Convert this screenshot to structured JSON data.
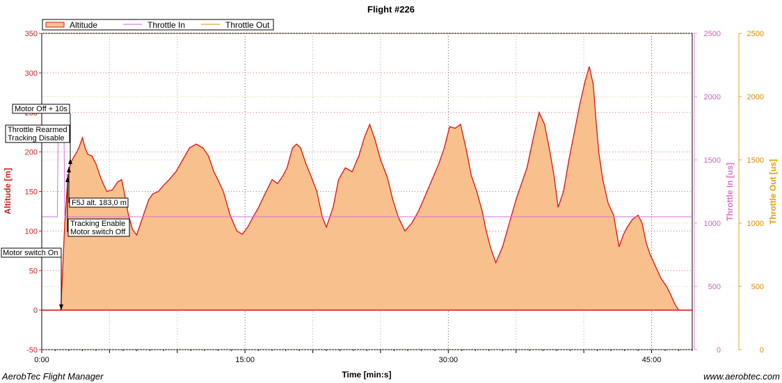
{
  "chart_data": {
    "type": "area",
    "title": "Flight #226",
    "xlabel": "Time [min:s]",
    "ylabel": "Altitude [m]",
    "ylabel_right_1": "Throttle In [us]",
    "ylabel_right_2": "Throttle Out [us]",
    "xlim_min": [
      0,
      48
    ],
    "ylim": [
      -50,
      350
    ],
    "y2lim": [
      0,
      2500
    ],
    "y3lim": [
      0,
      2500
    ],
    "x_ticks": [
      {
        "v": 0,
        "label": "0:00"
      },
      {
        "v": 15,
        "label": "15:00"
      },
      {
        "v": 30,
        "label": "30:00"
      },
      {
        "v": 45,
        "label": "45:00"
      }
    ],
    "y_ticks": [
      "-50",
      "0",
      "50",
      "100",
      "150",
      "200",
      "250",
      "300",
      "350"
    ],
    "y2_ticks": [
      "0",
      "500",
      "1000",
      "1500",
      "2000",
      "2500"
    ],
    "y3_ticks": [
      "0",
      "500",
      "1000",
      "1500",
      "2000",
      "2500"
    ],
    "legend": {
      "placement": "top-left",
      "entries": [
        {
          "label": "Altitude",
          "color": "#cc2222"
        },
        {
          "label": "Throttle In",
          "color": "#cc66cc"
        },
        {
          "label": "Throttle Out",
          "color": "#cc9900"
        }
      ]
    },
    "grid": true,
    "series": [
      {
        "name": "Altitude",
        "color": "#dd1111",
        "fill": "#f8c08c",
        "x": [
          0,
          1.4,
          1.5,
          1.7,
          1.9,
          2.1,
          2.4,
          2.6,
          2.8,
          3.0,
          3.2,
          3.4,
          3.7,
          4.0,
          4.4,
          4.8,
          5.2,
          5.6,
          5.9,
          6.1,
          6.4,
          6.7,
          7.0,
          7.3,
          7.6,
          7.9,
          8.2,
          8.6,
          9.0,
          9.4,
          9.9,
          10.4,
          10.9,
          11.4,
          11.9,
          12.3,
          12.7,
          13.0,
          13.4,
          13.9,
          14.4,
          14.8,
          15.2,
          15.6,
          16.0,
          16.5,
          17.0,
          17.4,
          17.8,
          18.1,
          18.5,
          18.8,
          19.1,
          19.5,
          19.9,
          20.3,
          20.7,
          21.0,
          21.5,
          21.9,
          22.4,
          22.9,
          23.4,
          23.8,
          24.2,
          24.6,
          25.0,
          25.5,
          25.9,
          26.3,
          26.8,
          27.3,
          27.8,
          28.3,
          28.8,
          29.3,
          29.7,
          30.1,
          30.5,
          30.9,
          31.3,
          31.7,
          32.1,
          32.5,
          32.8,
          33.1,
          33.5,
          34.0,
          34.5,
          35.0,
          35.4,
          35.8,
          36.3,
          36.7,
          37.1,
          37.5,
          37.8,
          38.1,
          38.5,
          38.9,
          39.3,
          39.7,
          40.1,
          40.4,
          40.7,
          40.9,
          41.1,
          41.4,
          41.8,
          42.2,
          42.6,
          42.9,
          43.2,
          43.6,
          44.0,
          44.3,
          44.6,
          44.9,
          45.3,
          45.7,
          46.1,
          46.4,
          46.7,
          47.0,
          47.3,
          47.6,
          48.0
        ],
        "y": [
          0,
          0,
          35,
          110,
          160,
          185,
          195,
          200,
          208,
          218,
          205,
          197,
          195,
          185,
          165,
          150,
          152,
          162,
          165,
          148,
          120,
          102,
          95,
          110,
          125,
          140,
          147,
          150,
          158,
          165,
          175,
          190,
          205,
          210,
          205,
          195,
          175,
          165,
          150,
          120,
          100,
          96,
          105,
          118,
          130,
          148,
          165,
          160,
          170,
          180,
          205,
          210,
          205,
          185,
          168,
          150,
          118,
          105,
          130,
          165,
          180,
          175,
          195,
          218,
          235,
          215,
          190,
          168,
          140,
          118,
          100,
          110,
          125,
          145,
          165,
          185,
          205,
          232,
          230,
          235,
          205,
          170,
          150,
          125,
          100,
          80,
          60,
          80,
          110,
          140,
          160,
          180,
          220,
          250,
          235,
          200,
          170,
          130,
          150,
          190,
          225,
          260,
          290,
          308,
          285,
          240,
          200,
          165,
          135,
          120,
          80,
          95,
          105,
          115,
          120,
          110,
          85,
          70,
          55,
          40,
          30,
          20,
          8,
          0,
          0,
          0,
          0
        ]
      },
      {
        "name": "Throttle In",
        "color": "#d870d8",
        "x": [
          0,
          1.15,
          1.2,
          1.65,
          1.7,
          48
        ],
        "y": [
          1050,
          1050,
          1650,
          1650,
          1050,
          1050
        ]
      }
    ],
    "annotations": [
      {
        "label": "Motor Off + 10s",
        "t": 2.1
      },
      {
        "label": "Throttle Rearmed",
        "t": 2.1
      },
      {
        "label": "Tracking Disable",
        "t": 2.1
      },
      {
        "label": "F5J alt. 183,0 m",
        "t": 2.1
      },
      {
        "label": "Tracking Enable",
        "t": 1.9
      },
      {
        "label": "Motor switch Off",
        "t": 1.9
      },
      {
        "label": "Motor switch On",
        "t": 1.4
      }
    ]
  },
  "footer": {
    "left": "AerobTec Flight Manager",
    "right": "www.aerobtec.com"
  }
}
